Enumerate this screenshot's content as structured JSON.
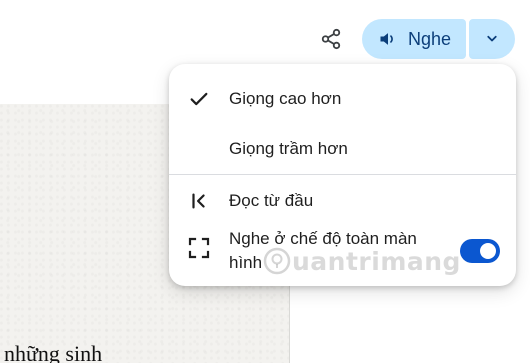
{
  "document": {
    "text_fragment": "những sinh"
  },
  "toolbar": {
    "share_icon": "share-icon",
    "listen_label": "Nghe",
    "listen_icon": "speaker-icon",
    "dropdown_icon": "chevron-down-icon",
    "accent_color": "#c2e7ff",
    "accent_text_color": "#0b3e7a"
  },
  "menu": {
    "items": [
      {
        "label": "Giọng cao hơn",
        "icon": "check-icon",
        "selected": true
      },
      {
        "label": "Giọng trầm hơn",
        "icon": "",
        "selected": false
      },
      {
        "label": "Đọc từ đầu",
        "icon": "skip-to-start-icon"
      },
      {
        "label": "Nghe ở chế độ toàn màn hình",
        "icon": "fullscreen-icon",
        "toggle": {
          "on": true,
          "color": "#0b57d0"
        }
      }
    ]
  },
  "watermark": {
    "text": "uantrimang"
  }
}
